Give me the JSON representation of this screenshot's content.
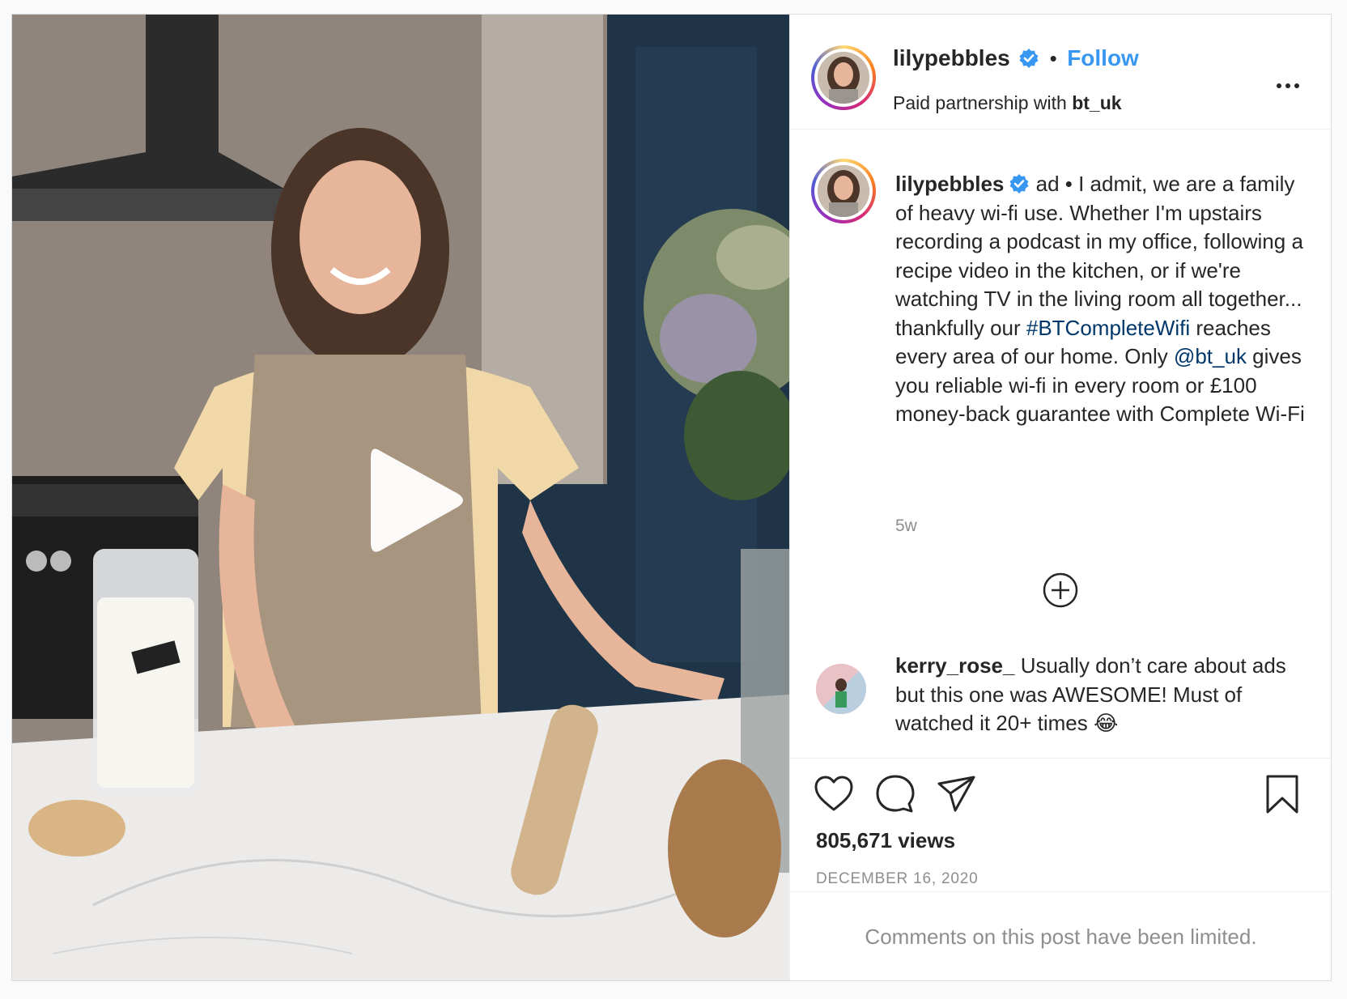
{
  "post": {
    "author": {
      "username": "lilypebbles",
      "verified": true,
      "follow_label": "Follow",
      "separator": "•",
      "partnership_prefix": "Paid partnership with",
      "partner": "bt_uk"
    },
    "caption": {
      "username": "lilypebbles",
      "prefix": " ad • I admit, we are a family of heavy wi-fi use. Whether I'm upstairs recording a podcast in my office, following a recipe video in the kitchen, or if we're watching TV in the living room all together... thankfully our ",
      "hashtag": "#BTCompleteWifi",
      "middle": " reaches every area of our home. Only ",
      "mention": "@bt_uk",
      "suffix": " gives you reliable wi-fi in every room or £100 money-back guarantee with Complete Wi-Fi",
      "time_ago": "5w"
    },
    "comment": {
      "username": "kerry_rose_",
      "text": " Usually don’t care about ads but this one was AWESOME! Must of watched it 20+ times 😂"
    },
    "views": "805,671 views",
    "date": "DECEMBER 16, 2020",
    "comments_limited": "Comments on this post have been limited.",
    "icons": {
      "like": "heart-icon",
      "comment": "comment-bubble-icon",
      "share": "paper-plane-icon",
      "save": "bookmark-icon",
      "more": "more-options-icon",
      "load_more": "plus-circle-icon",
      "play": "play-icon"
    },
    "colors": {
      "link": "#00376b",
      "follow": "#3897f0",
      "verified": "#3897f0",
      "muted": "#8e8e8e"
    }
  }
}
